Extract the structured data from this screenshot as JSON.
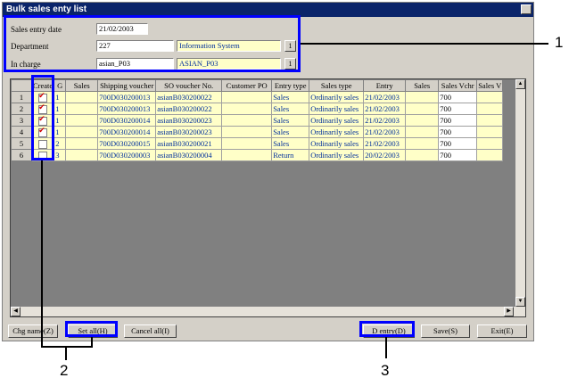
{
  "window": {
    "title": "Bulk sales enty list"
  },
  "header": {
    "sales_entry_date_label": "Sales entry date",
    "sales_entry_date_value": "21/02/2003",
    "department_label": "Department",
    "department_code": "227",
    "department_name": "Information System",
    "in_charge_label": "In charge",
    "in_charge_code": "asian_P03",
    "in_charge_name": "ASIAN_P03",
    "lookup_button": "1"
  },
  "grid": {
    "columns": [
      "Create",
      "G",
      "Sales",
      "Shipping voucher",
      "SO voucher No.",
      "Customer PO",
      "Entry type",
      "Sales type",
      "Entry",
      "Sales",
      "Sales Vchr",
      "Sales V"
    ],
    "rows": [
      {
        "num": "1",
        "create": true,
        "g": "1",
        "sales": "",
        "ship": "700D030200013",
        "so": "asianB030200022",
        "po": "",
        "etype": "Sales",
        "stype": "Ordinarily sales",
        "entry": "21/02/2003",
        "sales2": "",
        "vchr": "700"
      },
      {
        "num": "2",
        "create": true,
        "g": "1",
        "sales": "",
        "ship": "700D030200013",
        "so": "asianB030200022",
        "po": "",
        "etype": "Sales",
        "stype": "Ordinarily sales",
        "entry": "21/02/2003",
        "sales2": "",
        "vchr": "700"
      },
      {
        "num": "3",
        "create": true,
        "g": "1",
        "sales": "",
        "ship": "700D030200014",
        "so": "asianB030200023",
        "po": "",
        "etype": "Sales",
        "stype": "Ordinarily sales",
        "entry": "21/02/2003",
        "sales2": "",
        "vchr": "700"
      },
      {
        "num": "4",
        "create": true,
        "g": "1",
        "sales": "",
        "ship": "700D030200014",
        "so": "asianB030200023",
        "po": "",
        "etype": "Sales",
        "stype": "Ordinarily sales",
        "entry": "21/02/2003",
        "sales2": "",
        "vchr": "700"
      },
      {
        "num": "5",
        "create": false,
        "g": "2",
        "sales": "",
        "ship": "700D030200015",
        "so": "asianB030200021",
        "po": "",
        "etype": "Sales",
        "stype": "Ordinarily sales",
        "entry": "21/02/2003",
        "sales2": "",
        "vchr": "700"
      },
      {
        "num": "6",
        "create": false,
        "g": "3",
        "sales": "",
        "ship": "700D030200003",
        "so": "asianB030200004",
        "po": "",
        "etype": "Return",
        "stype": "Ordinarily sales",
        "entry": "20/02/2003",
        "sales2": "",
        "vchr": "700"
      }
    ]
  },
  "buttons": {
    "chg_name": "Chg name(Z)",
    "set_all": "Set all(H)",
    "cancel_all": "Cancel all(I)",
    "d_entry": "D entry(D)",
    "save": "Save(S)",
    "exit": "Exit(E)"
  },
  "callouts": {
    "one": "1",
    "two": "2",
    "three": "3"
  },
  "colors": {
    "highlight": "#0000ff",
    "titlebar": "#0a246a",
    "cell_yellow": "#ffffc8",
    "cell_text": "#00309c"
  }
}
